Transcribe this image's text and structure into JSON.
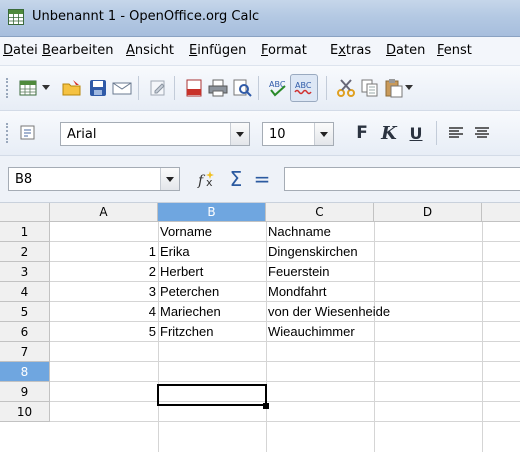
{
  "window": {
    "title": "Unbenannt 1 - OpenOffice.org Calc"
  },
  "menu": [
    {
      "label": "Datei",
      "u": ""
    },
    {
      "label": "Bearbeiten",
      "u": "B"
    },
    {
      "label": "Ansicht",
      "u": "A"
    },
    {
      "label": "Einfügen",
      "u": "E"
    },
    {
      "label": "Format",
      "u": "F"
    },
    {
      "label": "Extras",
      "u": "x"
    },
    {
      "label": "Daten",
      "u": "D"
    },
    {
      "label": "Fenst",
      "u": ""
    }
  ],
  "toolbar2": {
    "font_name": "Arial",
    "font_size": "10",
    "bold": "F",
    "italic": "K",
    "underline": "U"
  },
  "formula": {
    "cell_ref": "B8",
    "sum_symbol": "Σ",
    "equals": "=",
    "content": ""
  },
  "grid": {
    "columns": [
      "A",
      "B",
      "C",
      "D"
    ],
    "selected_column": "B",
    "rows": [
      "1",
      "2",
      "3",
      "4",
      "5",
      "6",
      "7",
      "8",
      "9",
      "10"
    ],
    "selected_row": "8",
    "cells": [
      {
        "row": 1,
        "a": "",
        "b": "Vorname",
        "c": "Nachname"
      },
      {
        "row": 2,
        "a": "1",
        "b": "Erika",
        "c": "Dingenskirchen"
      },
      {
        "row": 3,
        "a": "2",
        "b": "Herbert",
        "c": "Feuerstein"
      },
      {
        "row": 4,
        "a": "3",
        "b": "Peterchen",
        "c": "Mondfahrt"
      },
      {
        "row": 5,
        "a": "4",
        "b": "Mariechen",
        "c": "von der Wiesenheide"
      },
      {
        "row": 6,
        "a": "5",
        "b": "Fritzchen",
        "c": "Wieauchimmer"
      }
    ]
  },
  "colors": {
    "title_bar": "#b4c9e3",
    "selection_header": "#6fa6e0"
  }
}
